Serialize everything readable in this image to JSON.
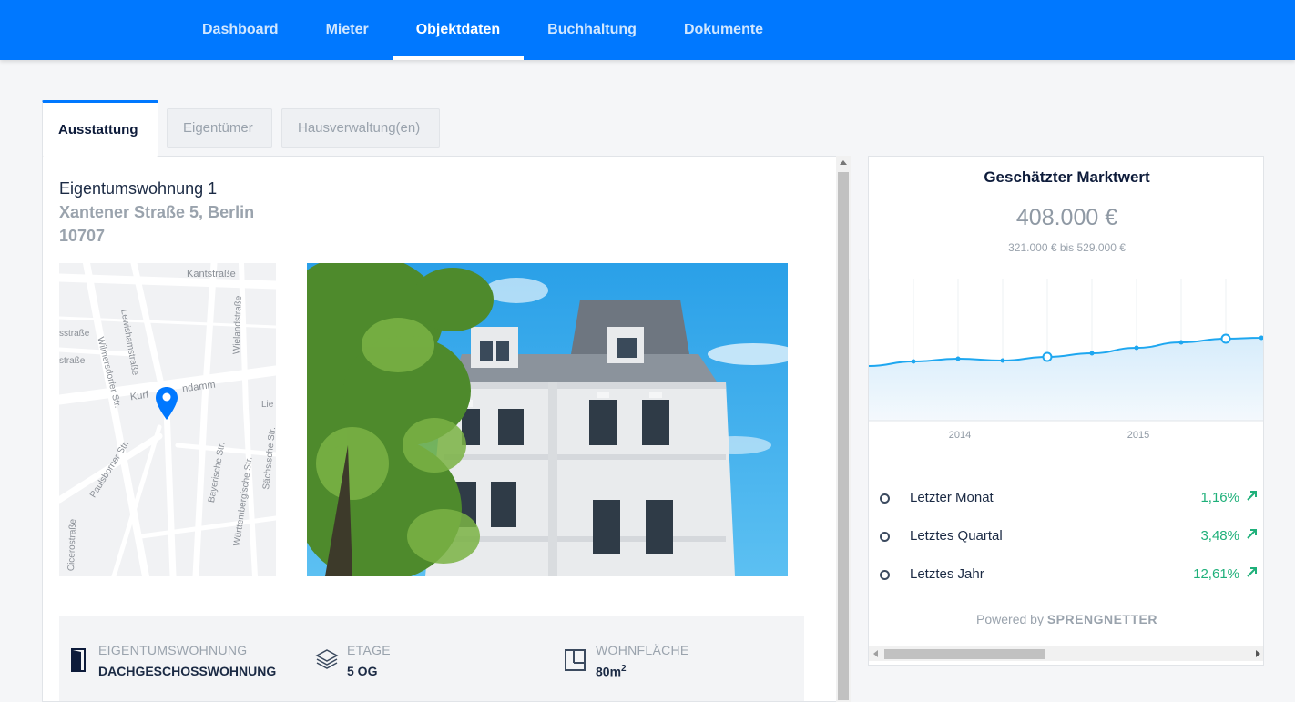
{
  "nav": {
    "items": [
      {
        "label": "Dashboard"
      },
      {
        "label": "Mieter"
      },
      {
        "label": "Objektdaten",
        "active": true
      },
      {
        "label": "Buchhaltung"
      },
      {
        "label": "Dokumente"
      }
    ]
  },
  "tabs": {
    "ausstattung": "Ausstattung",
    "eigentuemer": "Eigentümer",
    "hausverwaltung": "Hausverwaltung(en)"
  },
  "property": {
    "name": "Eigentumswohnung 1",
    "street": "Xantener Straße 5, Berlin",
    "zip": "10707"
  },
  "map": {
    "streets": [
      "Kantstraße",
      "Wilmersdorfer Str.",
      "Wielandstraße",
      "Lewishamstraße",
      "Kurfürstendamm",
      "Paulsborner Str.",
      "Bayerische Str.",
      "Württembergische Str.",
      "Sächsische Str.",
      "Cicerostraße"
    ],
    "partial_labels": [
      "sstraße",
      "straße",
      "Lie",
      "Kurf",
      "ndamm"
    ]
  },
  "props": {
    "type_label": "EIGENTUMSWOHNUNG",
    "type_value": "DACHGESCHOSSWOHNUNG",
    "floor_label": "ETAGE",
    "floor_value": "5 OG",
    "area_label": "WOHNFLÄCHE",
    "area_value": "80m",
    "area_sup": "2"
  },
  "market": {
    "title": "Geschätzter Marktwert",
    "value": "408.000 €",
    "range": "321.000 € bis 529.000 €",
    "powered_prefix": "Powered by",
    "powered_brand": "SPRENGNETTER"
  },
  "trends": [
    {
      "label": "Letzter Monat",
      "value": "1,16%"
    },
    {
      "label": "Letztes Quartal",
      "value": "3,48%"
    },
    {
      "label": "Letztes Jahr",
      "value": "12,61%"
    }
  ],
  "colors": {
    "accent": "#0078ff",
    "positive": "#1fb07a",
    "line": "#1ea7f0"
  },
  "chart_data": {
    "type": "area",
    "x_tick_labels": [
      "2014",
      "2015"
    ],
    "points": [
      {
        "t": 0.0,
        "v": 0.0
      },
      {
        "t": 1.0,
        "v": 0.05
      },
      {
        "t": 2.0,
        "v": 0.08
      },
      {
        "t": 3.0,
        "v": 0.06
      },
      {
        "t": 4.0,
        "v": 0.1
      },
      {
        "t": 5.0,
        "v": 0.14
      },
      {
        "t": 6.0,
        "v": 0.2
      },
      {
        "t": 7.0,
        "v": 0.26
      },
      {
        "t": 8.0,
        "v": 0.3
      },
      {
        "t": 8.8,
        "v": 0.31
      }
    ],
    "highlighted_points": [
      4,
      8
    ],
    "grid": true
  }
}
